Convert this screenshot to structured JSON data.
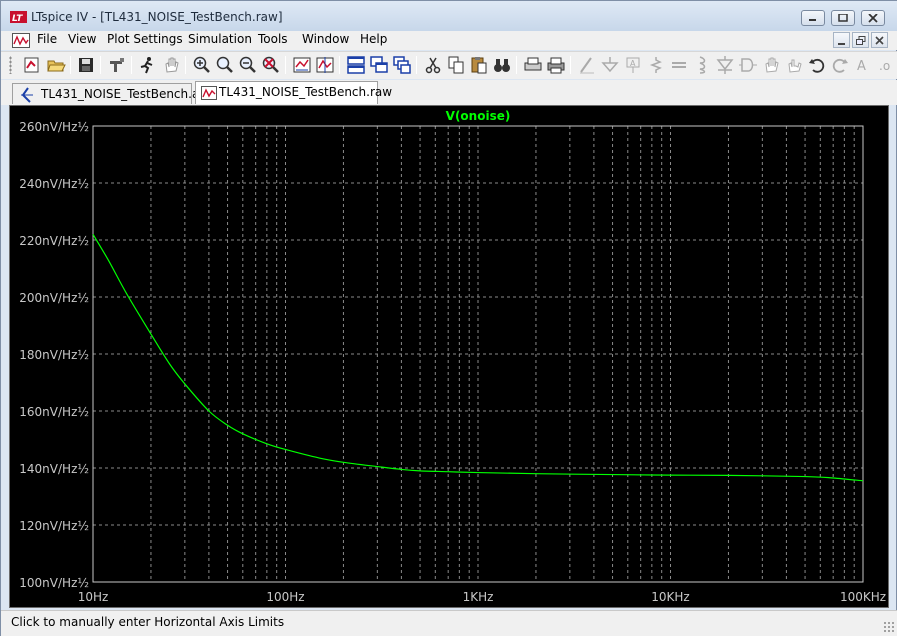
{
  "window": {
    "title": "LTspice IV - [TL431_NOISE_TestBench.raw]",
    "app_icon": "ltspice-logo-icon"
  },
  "menu": {
    "items": [
      "File",
      "View",
      "Plot Settings",
      "Simulation",
      "Tools",
      "Window",
      "Help"
    ]
  },
  "toolbar": {
    "icons": [
      "new-schematic-icon",
      "open-icon",
      "save-icon",
      "control-panel-icon",
      "run-icon",
      "halt-icon",
      "zoom-in-icon",
      "zoom-pan-icon",
      "zoom-out-icon",
      "zoom-cancel-icon",
      "autorange-icon",
      "pick-traces-icon",
      "tile-horizontal-icon",
      "cascade-icon",
      "tile-vertical-icon",
      "cut-icon",
      "copy-icon",
      "paste-icon",
      "find-icon",
      "print-preview-icon",
      "print-icon",
      "wire-icon",
      "ground-icon",
      "label-icon",
      "resistor-icon",
      "capacitor-icon",
      "inductor-icon",
      "diode-icon",
      "component-icon",
      "move-icon",
      "drag-icon",
      "undo-icon",
      "redo-icon",
      "text-icon"
    ]
  },
  "tabs": [
    {
      "label": "TL431_NOISE_TestBench.asc",
      "icon": "schematic-icon",
      "active": false
    },
    {
      "label": "TL431_NOISE_TestBench.raw",
      "icon": "waveform-icon",
      "active": true
    }
  ],
  "chart_data": {
    "type": "line",
    "title": "V(onoise)",
    "xlabel": "",
    "ylabel": "",
    "x_scale": "log",
    "xlim": [
      10,
      100000
    ],
    "ylim": [
      100,
      260
    ],
    "grid": true,
    "x_ticks": [
      {
        "value": 10,
        "label": "10Hz"
      },
      {
        "value": 100,
        "label": "100Hz"
      },
      {
        "value": 1000,
        "label": "1KHz"
      },
      {
        "value": 10000,
        "label": "10KHz"
      },
      {
        "value": 100000,
        "label": "100KHz"
      }
    ],
    "y_ticks": [
      {
        "value": 260,
        "label": "260nV/Hz½"
      },
      {
        "value": 240,
        "label": "240nV/Hz½"
      },
      {
        "value": 220,
        "label": "220nV/Hz½"
      },
      {
        "value": 200,
        "label": "200nV/Hz½"
      },
      {
        "value": 180,
        "label": "180nV/Hz½"
      },
      {
        "value": 160,
        "label": "160nV/Hz½"
      },
      {
        "value": 140,
        "label": "140nV/Hz½"
      },
      {
        "value": 120,
        "label": "120nV/Hz½"
      },
      {
        "value": 100,
        "label": "100nV/Hz½"
      }
    ],
    "series": [
      {
        "name": "V(onoise)",
        "color": "#00ff00",
        "x": [
          10,
          12,
          15,
          20,
          25,
          30,
          40,
          50,
          60,
          80,
          100,
          150,
          200,
          300,
          400,
          500,
          700,
          1000,
          2000,
          5000,
          10000,
          20000,
          50000,
          70000,
          100000
        ],
        "y": [
          222,
          213,
          201,
          187,
          176.5,
          169.5,
          160,
          155,
          152,
          148.5,
          146.5,
          143.5,
          142,
          140.5,
          139.5,
          139,
          138.7,
          138.4,
          138,
          137.7,
          137.5,
          137.4,
          137,
          136.5,
          135.5
        ]
      }
    ]
  },
  "status": {
    "text": "Click to manually enter Horizontal Axis Limits"
  }
}
